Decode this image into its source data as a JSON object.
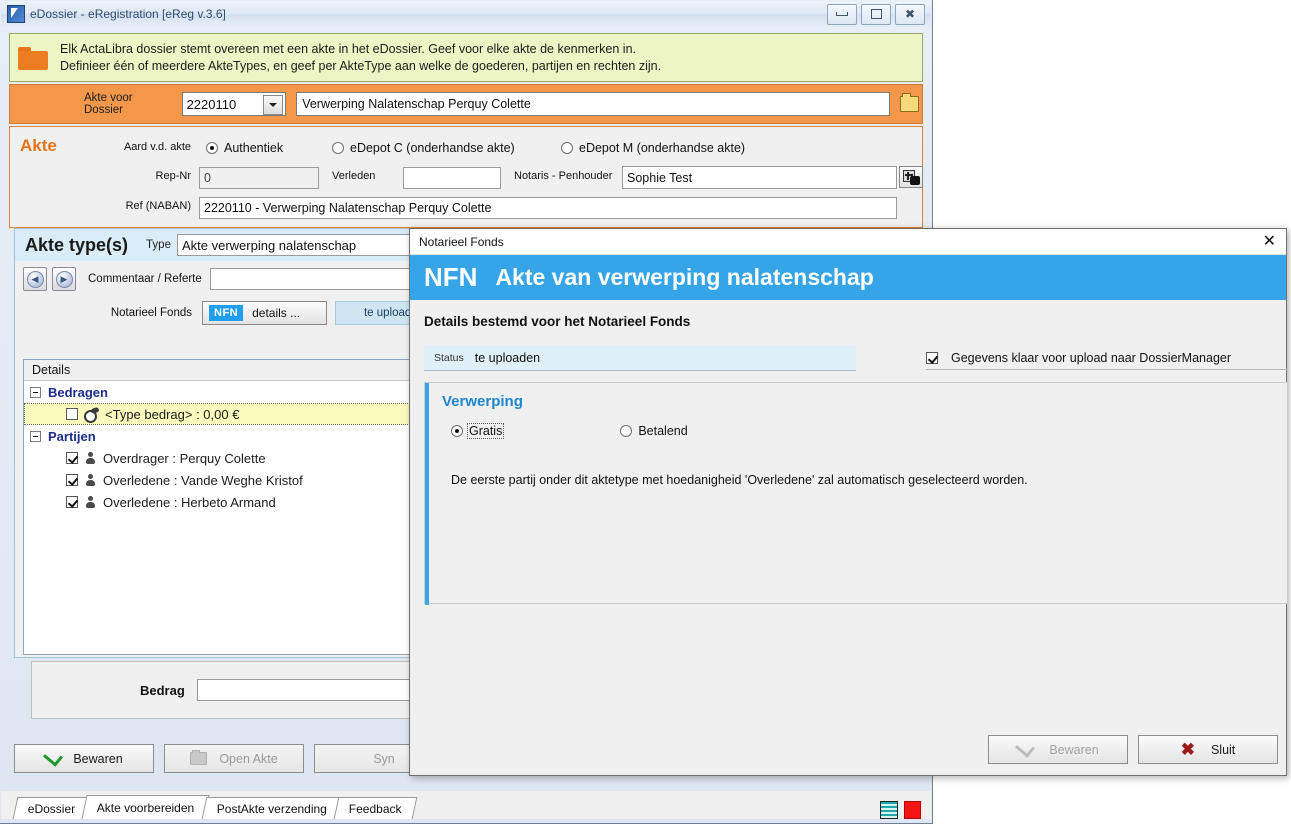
{
  "window": {
    "title": "eDossier - eRegistration [eReg v.3.6]",
    "min_label": "Minimize",
    "max_label": "Maximize",
    "close_label": "Close"
  },
  "info_band": {
    "line1": "Elk ActaLibra dossier stemt overeen met een akte in het eDossier. Geef voor elke akte de kenmerken in.",
    "line2": "Definieer één of meerdere AkteTypes, en geef per AkteType aan welke de goederen, partijen en rechten zijn."
  },
  "dossier": {
    "label": "Akte voor Dossier",
    "number": "2220110",
    "description": "Verwerping Nalatenschap Perquy Colette"
  },
  "akte": {
    "heading": "Akte",
    "aard_label": "Aard v.d. akte",
    "options": [
      {
        "label": "Authentiek",
        "selected": true
      },
      {
        "label": "eDepot C (onderhandse akte)",
        "selected": false
      },
      {
        "label": "eDepot M (onderhandse akte)",
        "selected": false
      }
    ],
    "repnr_label": "Rep-Nr",
    "repnr_value": "0",
    "verleden_label": "Verleden",
    "verleden_value": "",
    "notaris_label": "Notaris - Penhouder",
    "notaris_value": "Sophie Test",
    "ref_label": "Ref (NABAN)",
    "ref_value": "2220110 - Verwerping Nalatenschap Perquy Colette"
  },
  "aktetype": {
    "title": "Akte type(s)",
    "type_label": "Type",
    "type_value": "Akte verwerping nalatenschap",
    "commentaar_label": "Commentaar / Referte",
    "commentaar_value": "",
    "fonds_label": "Notarieel Fonds",
    "nfn_badge": "NFN",
    "details_label": "details ...",
    "upload_status": "te uploaden",
    "tree_header": "Details",
    "tree": [
      {
        "group": "Bedragen",
        "children": [
          {
            "label": "<Type bedrag> : 0,00 €",
            "checked": false,
            "icon": "money-icon",
            "highlight": true
          }
        ]
      },
      {
        "group": "Partijen",
        "children": [
          {
            "label": "Overdrager : Perquy Colette",
            "checked": true,
            "icon": "person-icon",
            "highlight": false
          },
          {
            "label": "Overledene : Vande Weghe Kristof",
            "checked": true,
            "icon": "person-icon",
            "highlight": false
          },
          {
            "label": "Overledene : Herbeto Armand",
            "checked": true,
            "icon": "person-icon",
            "highlight": false
          }
        ]
      }
    ],
    "bedrag_label": "Bedrag",
    "bedrag_value": ""
  },
  "actions": {
    "bewaren": "Bewaren",
    "open_akte": "Open Akte",
    "sync": "Syn"
  },
  "tabs": [
    {
      "label": "eDossier",
      "active": false
    },
    {
      "label": "Akte voorbereiden",
      "active": true
    },
    {
      "label": "PostAkte verzending",
      "active": false
    },
    {
      "label": "Feedback",
      "active": false
    }
  ],
  "modal": {
    "window_title": "Notarieel Fonds",
    "banner_badge": "NFN",
    "banner_title": "Akte van verwerping nalatenschap",
    "subtitle": "Details bestemd voor het Notarieel Fonds",
    "status_label": "Status",
    "status_value": "te uploaden",
    "ready_label": "Gegevens klaar voor upload naar DossierManager",
    "ready_checked": true,
    "section_title": "Verwerping",
    "options": [
      {
        "label": "Gratis",
        "selected": true
      },
      {
        "label": "Betalend",
        "selected": false
      }
    ],
    "note": "De eerste partij onder dit aktetype met hoedanigheid 'Overledene' zal automatisch geselecteerd worden.",
    "save_label": "Bewaren",
    "close_label": "Sluit"
  },
  "colors": {
    "accent_blue": "#35a5e8",
    "orange": "#f3974a",
    "info_yellow": "#eef5c4",
    "highlight_yellow": "#fbfbbd",
    "nfn_blue": "#1e9ef0"
  }
}
